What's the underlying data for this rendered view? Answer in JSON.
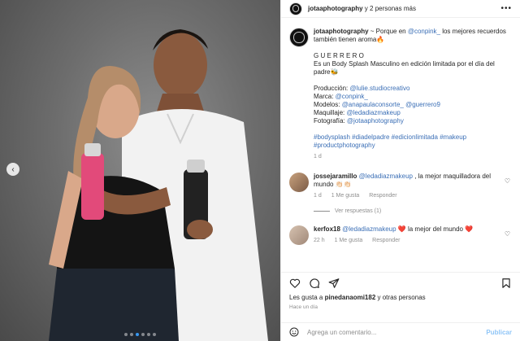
{
  "header": {
    "username": "jotaaphotography",
    "collaborators": "y 2 personas más",
    "more_icon": "more-horizontal-icon"
  },
  "caption": {
    "username": "jotaaphotography",
    "line1": " ~ Porque en ",
    "mention_conpink": "@conpink_",
    "line1b": " los mejores recuerdos también tienen aroma🔥",
    "title": "G U E R R E R O",
    "desc": "Es un Body Splash Masculino en edición limitada por el día del padre🐝",
    "prod_label": "Producción: ",
    "prod_value": "@lulie.studiocreativo",
    "brand_label": "Marca: ",
    "brand_value": "@conpink_",
    "models_label": "Modelos: ",
    "models_value": "@anapaulaconsorte_ @guerrero9",
    "makeup_label": "Maquillaje: ",
    "makeup_value": "@ledadiazmakeup",
    "photo_label": "Fotografía: ",
    "photo_value": "@jotaaphotography",
    "hashtags": "#bodysplash #diadelpadre #edicionlimitada #makeup #productphotography",
    "time": "1 d"
  },
  "comments": [
    {
      "username": "jossejaramillo",
      "mention": "@ledadiazmakeup",
      "text": " , la mejor maquilladora del mundo 👏🏻👏🏻",
      "time": "1 d",
      "likes": "1 Me gusta",
      "reply": "Responder",
      "view_replies": "Ver respuestas (1)"
    },
    {
      "username": "kerfox18",
      "mention": "@ledadiazmakeup",
      "text_a": " ",
      "heart": "❤️",
      "text_b": " la mejor del mundo ",
      "time": "22 h",
      "likes": "1 Me gusta",
      "reply": "Responder"
    }
  ],
  "likes": {
    "prefix": "Les gusta a ",
    "user": "pinedanaomi182",
    "suffix": " y otras personas"
  },
  "posted": "Hace un día",
  "composer": {
    "placeholder": "Agrega un comentario...",
    "post_label": "Publicar"
  },
  "carousel": {
    "slides": 6,
    "active": 2
  },
  "colors": {
    "accent": "#3797f0",
    "link": "#00376b",
    "heart": "#ed4956"
  }
}
